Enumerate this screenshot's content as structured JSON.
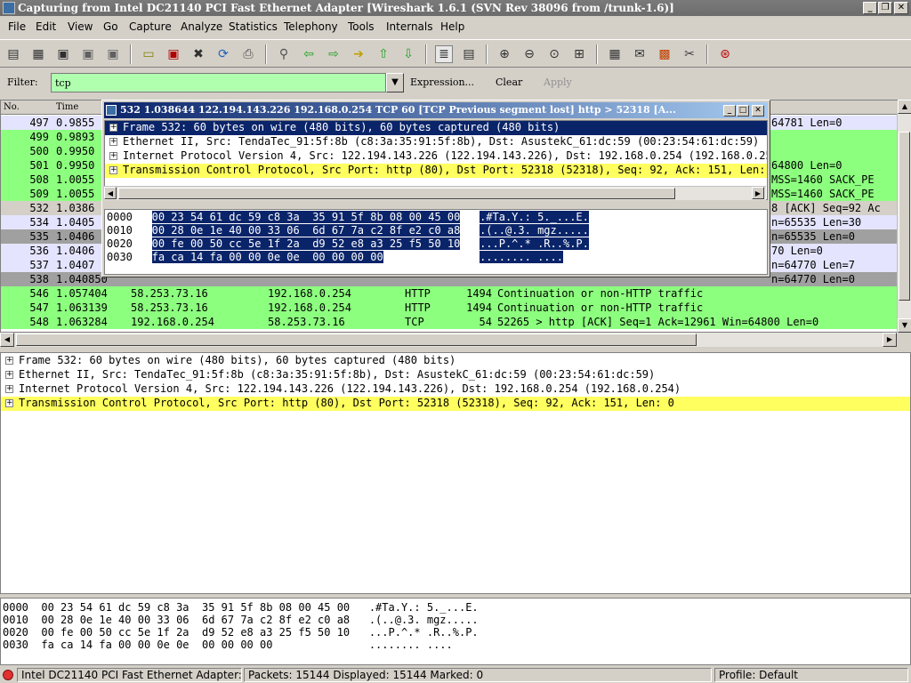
{
  "window": {
    "title": "Capturing from Intel DC21140 PCI Fast Ethernet Adapter    [Wireshark 1.6.1  (SVN Rev 38096 from /trunk-1.6)]"
  },
  "menu": [
    "File",
    "Edit",
    "View",
    "Go",
    "Capture",
    "Analyze",
    "Statistics",
    "Telephony",
    "Tools",
    "Internals",
    "Help"
  ],
  "toolbar": {
    "icons": [
      "interface-list-icon",
      "capture-options-icon",
      "start-capture-icon",
      "stop-capture-icon",
      "restart-capture-icon",
      "open-icon",
      "save-icon",
      "close-icon",
      "reload-icon",
      "print-icon",
      "find-icon",
      "back-icon",
      "forward-icon",
      "goto-icon",
      "first-icon",
      "last-icon",
      "colorize-icon",
      "autoscroll-icon",
      "zoom-in-icon",
      "zoom-out-icon",
      "normal-size-icon",
      "resize-columns-icon",
      "capture-filters-icon",
      "display-filters-icon",
      "coloring-rules-icon",
      "preferences-icon",
      "help-icon"
    ]
  },
  "filter": {
    "label": "Filter:",
    "value": "tcp",
    "expression": "Expression...",
    "clear": "Clear",
    "apply": "Apply"
  },
  "packet_list": {
    "columns": [
      "No.",
      "Time"
    ],
    "rows": [
      {
        "no": "497",
        "time": "0.9855",
        "src": "",
        "dst": "",
        "proto": "",
        "len": "",
        "info": "64781 Len=0",
        "color": "#e4e4ff"
      },
      {
        "no": "499",
        "time": "0.9893",
        "src": "",
        "dst": "",
        "proto": "",
        "len": "",
        "info": "",
        "color": "#8dff7f"
      },
      {
        "no": "500",
        "time": "0.9950",
        "src": "",
        "dst": "",
        "proto": "",
        "len": "",
        "info": "",
        "color": "#8dff7f"
      },
      {
        "no": "501",
        "time": "0.9950",
        "src": "",
        "dst": "",
        "proto": "",
        "len": "",
        "info": "64800 Len=0",
        "color": "#8dff7f"
      },
      {
        "no": "508",
        "time": "1.0055",
        "src": "",
        "dst": "",
        "proto": "",
        "len": "",
        "info": "MSS=1460 SACK_PE",
        "color": "#8dff7f"
      },
      {
        "no": "509",
        "time": "1.0055",
        "src": "",
        "dst": "",
        "proto": "",
        "len": "",
        "info": "MSS=1460 SACK_PE",
        "color": "#8dff7f"
      },
      {
        "no": "532",
        "time": "1.0386",
        "src": "",
        "dst": "",
        "proto": "",
        "len": "",
        "info": "8 [ACK] Seq=92 Ac",
        "color": "#d4d0c8"
      },
      {
        "no": "534",
        "time": "1.0405",
        "src": "",
        "dst": "",
        "proto": "",
        "len": "",
        "info": "n=65535 Len=30",
        "color": "#e4e4ff"
      },
      {
        "no": "535",
        "time": "1.0406",
        "src": "",
        "dst": "",
        "proto": "",
        "len": "",
        "info": "n=65535 Len=0",
        "color": "#a0a0a0"
      },
      {
        "no": "536",
        "time": "1.0406",
        "src": "",
        "dst": "",
        "proto": "",
        "len": "",
        "info": "70 Len=0",
        "color": "#e4e4ff"
      },
      {
        "no": "537",
        "time": "1.0407",
        "src": "",
        "dst": "",
        "proto": "",
        "len": "",
        "info": "n=64770 Len=7",
        "color": "#e4e4ff"
      },
      {
        "no": "538",
        "time": "1.040850",
        "src": "",
        "dst": "",
        "proto": "",
        "len": "",
        "info": "n=64770 Len=0",
        "color": "#a0a0a0"
      },
      {
        "no": "546",
        "time": "1.057404",
        "src": "58.253.73.16",
        "dst": "192.168.0.254",
        "proto": "HTTP",
        "len": "1494",
        "info": "Continuation or non-HTTP traffic",
        "color": "#8dff7f"
      },
      {
        "no": "547",
        "time": "1.063139",
        "src": "58.253.73.16",
        "dst": "192.168.0.254",
        "proto": "HTTP",
        "len": "1494",
        "info": "Continuation or non-HTTP traffic",
        "color": "#8dff7f"
      },
      {
        "no": "548",
        "time": "1.063284",
        "src": "192.168.0.254",
        "dst": "58.253.73.16",
        "proto": "TCP",
        "len": "54",
        "info": "52265 > http [ACK] Seq=1 Ack=12961 Win=64800 Len=0",
        "color": "#8dff7f"
      }
    ]
  },
  "details": [
    {
      "text": "Frame 532: 60 bytes on wire (480 bits), 60 bytes captured (480 bits)",
      "bg": "#ffffff"
    },
    {
      "text": "Ethernet II, Src: TendaTec_91:5f:8b (c8:3a:35:91:5f:8b), Dst: AsustekC_61:dc:59 (00:23:54:61:dc:59)",
      "bg": "#ffffff"
    },
    {
      "text": "Internet Protocol Version 4, Src: 122.194.143.226 (122.194.143.226), Dst: 192.168.0.254 (192.168.0.254)",
      "bg": "#ffffff"
    },
    {
      "text": "Transmission Control Protocol, Src Port: http (80), Dst Port: 52318 (52318), Seq: 92, Ack: 151, Len: 0",
      "bg": "#ffff60"
    }
  ],
  "bytes": [
    {
      "off": "0000",
      "hex": "00 23 54 61 dc 59 c8 3a  35 91 5f 8b 08 00 45 00",
      "ascii": ".#Ta.Y.: 5._...E."
    },
    {
      "off": "0010",
      "hex": "00 28 0e 1e 40 00 33 06  6d 67 7a c2 8f e2 c0 a8",
      "ascii": ".(..@.3. mgz....."
    },
    {
      "off": "0020",
      "hex": "00 fe 00 50 cc 5e 1f 2a  d9 52 e8 a3 25 f5 50 10",
      "ascii": "...P.^.* .R..%.P."
    },
    {
      "off": "0030",
      "hex": "fa ca 14 fa 00 00 0e 0e  00 00 00 00",
      "ascii": "........ ...."
    }
  ],
  "popup": {
    "title": "532 1.038644 122.194.143.226 192.168.0.254 TCP 60 [TCP Previous segment lost] http > 52318 [A...",
    "tree": [
      {
        "text": "Frame 532: 60 bytes on wire (480 bits), 60 bytes captured (480 bits)",
        "bg": "#0a246a",
        "fg": "#ffffff"
      },
      {
        "text": "Ethernet II, Src: TendaTec_91:5f:8b (c8:3a:35:91:5f:8b), Dst: AsustekC_61:dc:59 (00:23:54:61:dc:59)",
        "bg": "#ffffff",
        "fg": "#000000"
      },
      {
        "text": "Internet Protocol Version 4, Src: 122.194.143.226 (122.194.143.226), Dst: 192.168.0.254 (192.168.0.254)",
        "bg": "#ffffff",
        "fg": "#000000"
      },
      {
        "text": "Transmission Control Protocol, Src Port: http (80), Dst Port: 52318 (52318), Seq: 92, Ack: 151, Len: 0",
        "bg": "#ffff60",
        "fg": "#000000"
      }
    ]
  },
  "status": {
    "interface": "Intel DC21140 PCI Fast Ethernet Adapter: <",
    "packets": "Packets: 15144 Displayed: 15144 Marked: 0",
    "profile": "Profile: Default"
  }
}
